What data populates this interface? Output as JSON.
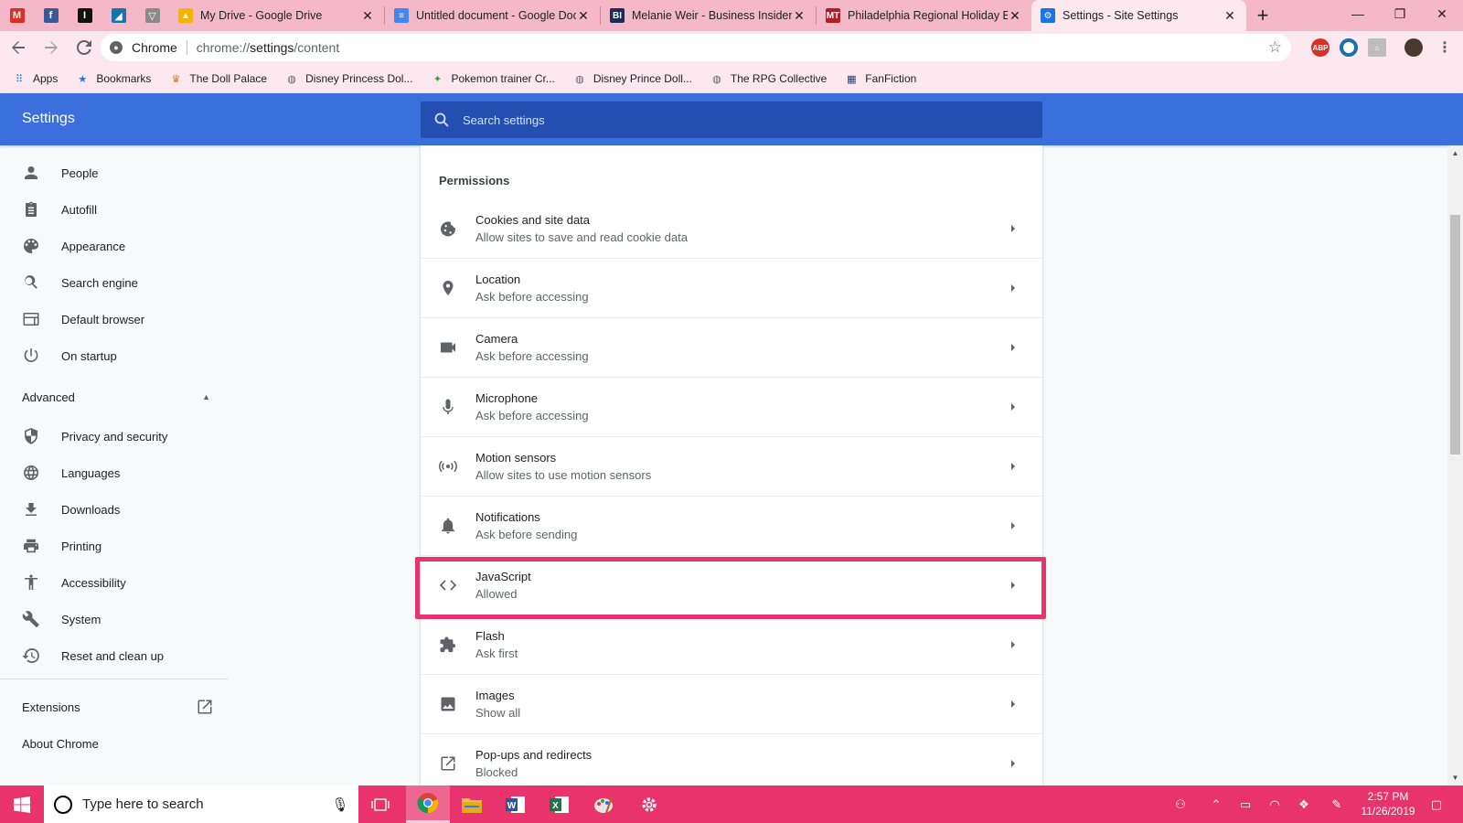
{
  "browser": {
    "pinned_tabs": [
      {
        "icon": "gmail-icon",
        "glyph": "M",
        "color": "#d93025"
      },
      {
        "icon": "facebook-icon",
        "glyph": "f",
        "color": "#3b5998"
      },
      {
        "icon": "instapaper-icon",
        "glyph": "I",
        "color": "#111111"
      },
      {
        "icon": "app-icon",
        "glyph": "◢",
        "color": "#1a73a8"
      },
      {
        "icon": "drive-shortcut-icon",
        "glyph": "▽",
        "color": "#8a8a8a"
      }
    ],
    "tabs": [
      {
        "title": "My Drive - Google Drive",
        "icon": "google-drive-icon",
        "glyph": "▲",
        "color": "#f4b400"
      },
      {
        "title": "Untitled document - Google Docs",
        "icon": "google-docs-icon",
        "glyph": "≡",
        "color": "#4285f4"
      },
      {
        "title": "Melanie Weir - Business Insider",
        "icon": "business-insider-icon",
        "glyph": "BI",
        "color": "#1a2c57"
      },
      {
        "title": "Philadelphia Regional Holiday Events",
        "icon": "mt-icon",
        "glyph": "MT",
        "color": "#b01e28"
      },
      {
        "title": "Settings - Site Settings",
        "icon": "settings-gear-icon",
        "glyph": "⚙",
        "color": "#1a73e8"
      }
    ],
    "omnibox": {
      "chip": "Chrome",
      "url_scheme": "chrome://",
      "url_host": "settings",
      "url_path": "/content"
    },
    "bookmarks": [
      {
        "label": "Apps",
        "icon": "apps-grid-icon",
        "glyph": "⠿",
        "color": "#1a73e8"
      },
      {
        "label": "Bookmarks",
        "icon": "star-icon",
        "glyph": "★",
        "color": "#1a73e8"
      },
      {
        "label": "The Doll Palace",
        "icon": "doll-palace-icon",
        "glyph": "♛",
        "color": "#c77d2e"
      },
      {
        "label": "Disney Princess Dol...",
        "icon": "globe-icon",
        "glyph": "◍",
        "color": "#5f6368"
      },
      {
        "label": "Pokemon trainer Cr...",
        "icon": "pokemon-icon",
        "glyph": "✦",
        "color": "#2ea043"
      },
      {
        "label": "Disney Prince Doll...",
        "icon": "globe-icon",
        "glyph": "◍",
        "color": "#5f6368"
      },
      {
        "label": "The RPG Collective",
        "icon": "globe-icon",
        "glyph": "◍",
        "color": "#5f6368"
      },
      {
        "label": "FanFiction",
        "icon": "fanfiction-icon",
        "glyph": "▦",
        "color": "#1c3f7a"
      }
    ]
  },
  "settings": {
    "title": "Settings",
    "search_placeholder": "Search settings",
    "sidebar": {
      "items": [
        {
          "label": "People",
          "icon": "person-icon"
        },
        {
          "label": "Autofill",
          "icon": "clipboard-icon"
        },
        {
          "label": "Appearance",
          "icon": "palette-icon"
        },
        {
          "label": "Search engine",
          "icon": "search-icon"
        },
        {
          "label": "Default browser",
          "icon": "browser-window-icon"
        },
        {
          "label": "On startup",
          "icon": "power-icon"
        }
      ],
      "advanced_label": "Advanced",
      "advanced_items": [
        {
          "label": "Privacy and security",
          "icon": "shield-icon"
        },
        {
          "label": "Languages",
          "icon": "globe-icon"
        },
        {
          "label": "Downloads",
          "icon": "download-icon"
        },
        {
          "label": "Printing",
          "icon": "printer-icon"
        },
        {
          "label": "Accessibility",
          "icon": "accessibility-icon"
        },
        {
          "label": "System",
          "icon": "wrench-icon"
        },
        {
          "label": "Reset and clean up",
          "icon": "history-icon"
        }
      ],
      "extensions_label": "Extensions",
      "about_label": "About Chrome"
    },
    "permissions_heading": "Permissions",
    "permissions": [
      {
        "title": "Cookies and site data",
        "subtitle": "Allow sites to save and read cookie data",
        "icon": "cookie-icon"
      },
      {
        "title": "Location",
        "subtitle": "Ask before accessing",
        "icon": "location-pin-icon"
      },
      {
        "title": "Camera",
        "subtitle": "Ask before accessing",
        "icon": "camera-icon"
      },
      {
        "title": "Microphone",
        "subtitle": "Ask before accessing",
        "icon": "microphone-icon"
      },
      {
        "title": "Motion sensors",
        "subtitle": "Allow sites to use motion sensors",
        "icon": "motion-sensor-icon"
      },
      {
        "title": "Notifications",
        "subtitle": "Ask before sending",
        "icon": "bell-icon"
      },
      {
        "title": "JavaScript",
        "subtitle": "Allowed",
        "icon": "code-icon"
      },
      {
        "title": "Flash",
        "subtitle": "Ask first",
        "icon": "puzzle-icon"
      },
      {
        "title": "Images",
        "subtitle": "Show all",
        "icon": "image-icon"
      },
      {
        "title": "Pop-ups and redirects",
        "subtitle": "Blocked",
        "icon": "open-in-new-icon"
      }
    ],
    "highlighted_row": "JavaScript",
    "highlight_color": "#e8336d"
  },
  "taskbar": {
    "search_placeholder": "Type here to search",
    "time": "2:57 PM",
    "date": "11/26/2019",
    "color": "#e8336d"
  }
}
